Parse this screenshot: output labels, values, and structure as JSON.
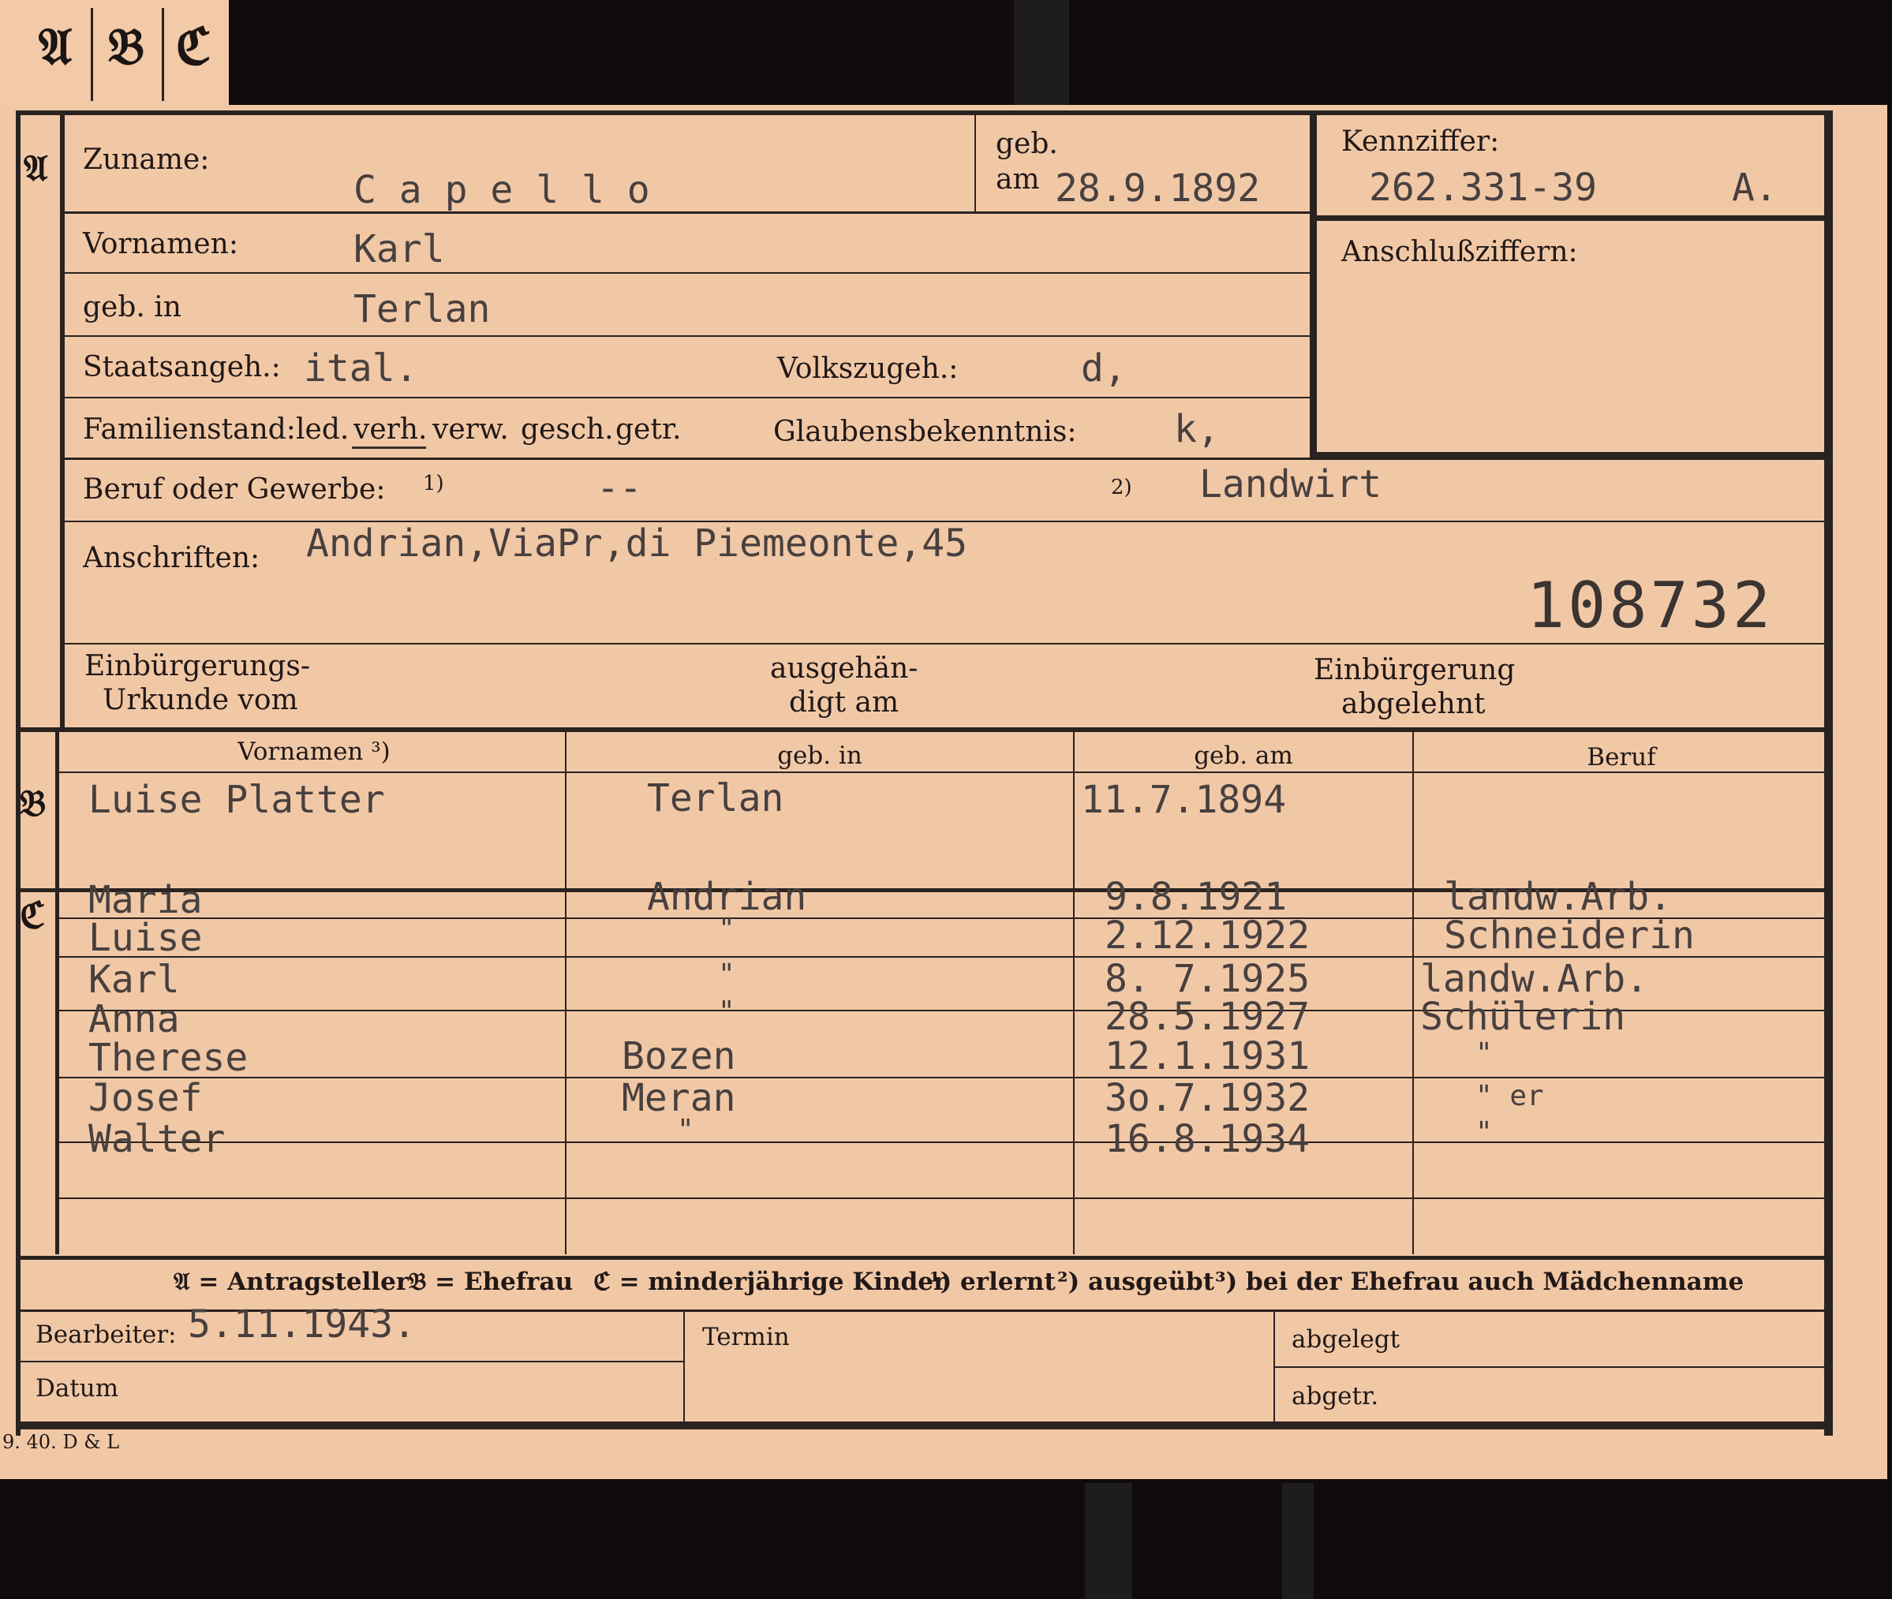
{
  "tabs": [
    "𝔄",
    "𝔅",
    "ℭ"
  ],
  "section_a": {
    "marker": "𝔄",
    "zuname_label": "Zuname:",
    "zuname": "C a p e l l o",
    "geb_label_1": "geb.",
    "geb_label_2": "am",
    "geb_am": "28.9.1892",
    "kennziffer_label": "Kennziffer:",
    "kennziffer": "262.331-39",
    "kennziffer_suffix": "A.",
    "anschluss_label": "Anschlußziffern:",
    "vornamen_label": "Vornamen:",
    "vornamen": "Karl",
    "geb_in_label": "geb. in",
    "geb_in": "Terlan",
    "staat_label": "Staatsangeh.:",
    "staat": "ital.",
    "volk_label": "Volkszugeh.:",
    "volk": "d,",
    "familienstand_label": "Familienstand:",
    "familienstand_options": [
      "led.",
      "verh.",
      "verw.",
      "gesch.",
      "getr."
    ],
    "familienstand_selected": "verh.",
    "glauben_label": "Glaubensbekenntnis:",
    "glauben": "k,",
    "beruf_label": "Beruf oder Gewerbe:",
    "fn1": "1)",
    "beruf_erlernt": "--",
    "fn2": "2)",
    "beruf_ausgeuebt": "Landwirt",
    "anschriften_label": "Anschriften:",
    "anschrift": "Andrian,ViaPr,di Piemeonte,45",
    "stamp_number": "108732",
    "einb_label_1": "Einbürgerungs-",
    "einb_label_2": "Urkunde vom",
    "ausg_label_1": "ausgehän-",
    "ausg_label_2": "digt am",
    "abgelehnt_label_1": "Einbürgerung",
    "abgelehnt_label_2": "abgelehnt"
  },
  "table_headers": [
    "Vornamen ³)",
    "geb. in",
    "geb. am",
    "Beruf"
  ],
  "section_b": {
    "marker": "𝔅",
    "vornamen": "Luise Platter",
    "geb_in": "Terlan",
    "geb_am": "11.7.1894",
    "beruf": ""
  },
  "section_c": {
    "marker": "ℭ",
    "children": [
      {
        "vornamen": "Maria",
        "geb_in": "Andrian",
        "geb_am": "9.8.1921",
        "beruf": "landw.Arb."
      },
      {
        "vornamen": "Luise",
        "geb_in": "\"",
        "geb_am": "2.12.1922",
        "beruf": "Schneiderin"
      },
      {
        "vornamen": "Karl",
        "geb_in": "\"",
        "geb_am": "8. 7.1925",
        "beruf": "landw.Arb."
      },
      {
        "vornamen": "Anna",
        "geb_in": "\"",
        "geb_am": "28.5.1927",
        "beruf": "Schülerin"
      },
      {
        "vornamen": "Therese",
        "geb_in": "Bozen",
        "geb_am": "12.1.1931",
        "beruf": "\""
      },
      {
        "vornamen": "Josef",
        "geb_in": "Meran",
        "geb_am": "3o.7.1932",
        "beruf": "\"  er"
      },
      {
        "vornamen": "Walter",
        "geb_in": "\"",
        "geb_am": "16.8.1934",
        "beruf": "\""
      }
    ]
  },
  "legend": {
    "a": "𝔄 = Antragsteller",
    "b": "𝔅 = Ehefrau",
    "c": "ℭ = minderjährige Kinder",
    "f1": "¹) erlernt",
    "f2": "²) ausgeübt",
    "f3": "³) bei der Ehefrau auch Mädchenname"
  },
  "footer": {
    "bearbeiter_label": "Bearbeiter:",
    "bearbeiter_value": "5.11.1943.",
    "termin_label": "Termin",
    "abgelegt_label": "abgelegt",
    "datum_label": "Datum",
    "abgetr_label": "abgetr.",
    "print_code": "9. 40. D & L"
  },
  "colors": {
    "card": "#f1c8a6",
    "ink": "#211817",
    "typewriter": "#48403f",
    "background": "#0f0c0b"
  }
}
